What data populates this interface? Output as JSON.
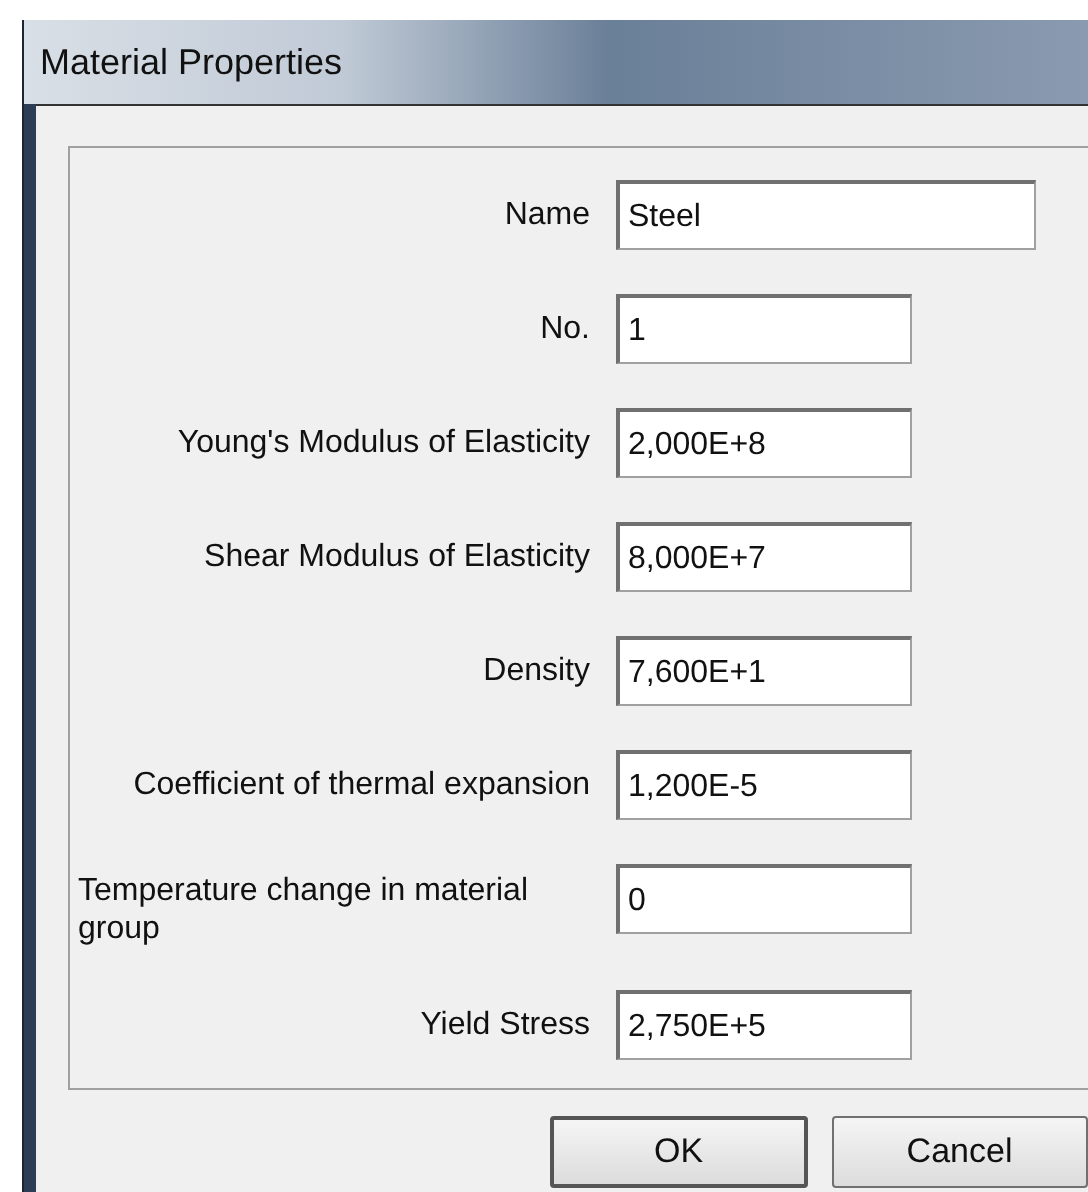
{
  "window": {
    "title": "Material Properties"
  },
  "fields": [
    {
      "label": "Name",
      "value": "Steel",
      "kind": "wide"
    },
    {
      "label": "No.",
      "value": "1",
      "kind": "normal"
    },
    {
      "label": "Young's Modulus of Elasticity",
      "value": "2,000E+8",
      "kind": "normal"
    },
    {
      "label": "Shear Modulus of Elasticity",
      "value": "8,000E+7",
      "kind": "normal"
    },
    {
      "label": "Density",
      "value": "7,600E+1",
      "kind": "normal"
    },
    {
      "label": "Coefficient of thermal expansion",
      "value": "1,200E-5",
      "kind": "normal"
    },
    {
      "label": "Temperature change in material group",
      "value": "0",
      "kind": "wrapped"
    },
    {
      "label": "Yield Stress",
      "value": "2,750E+5",
      "kind": "normal"
    }
  ],
  "buttons": [
    "OK",
    "Cancel"
  ]
}
